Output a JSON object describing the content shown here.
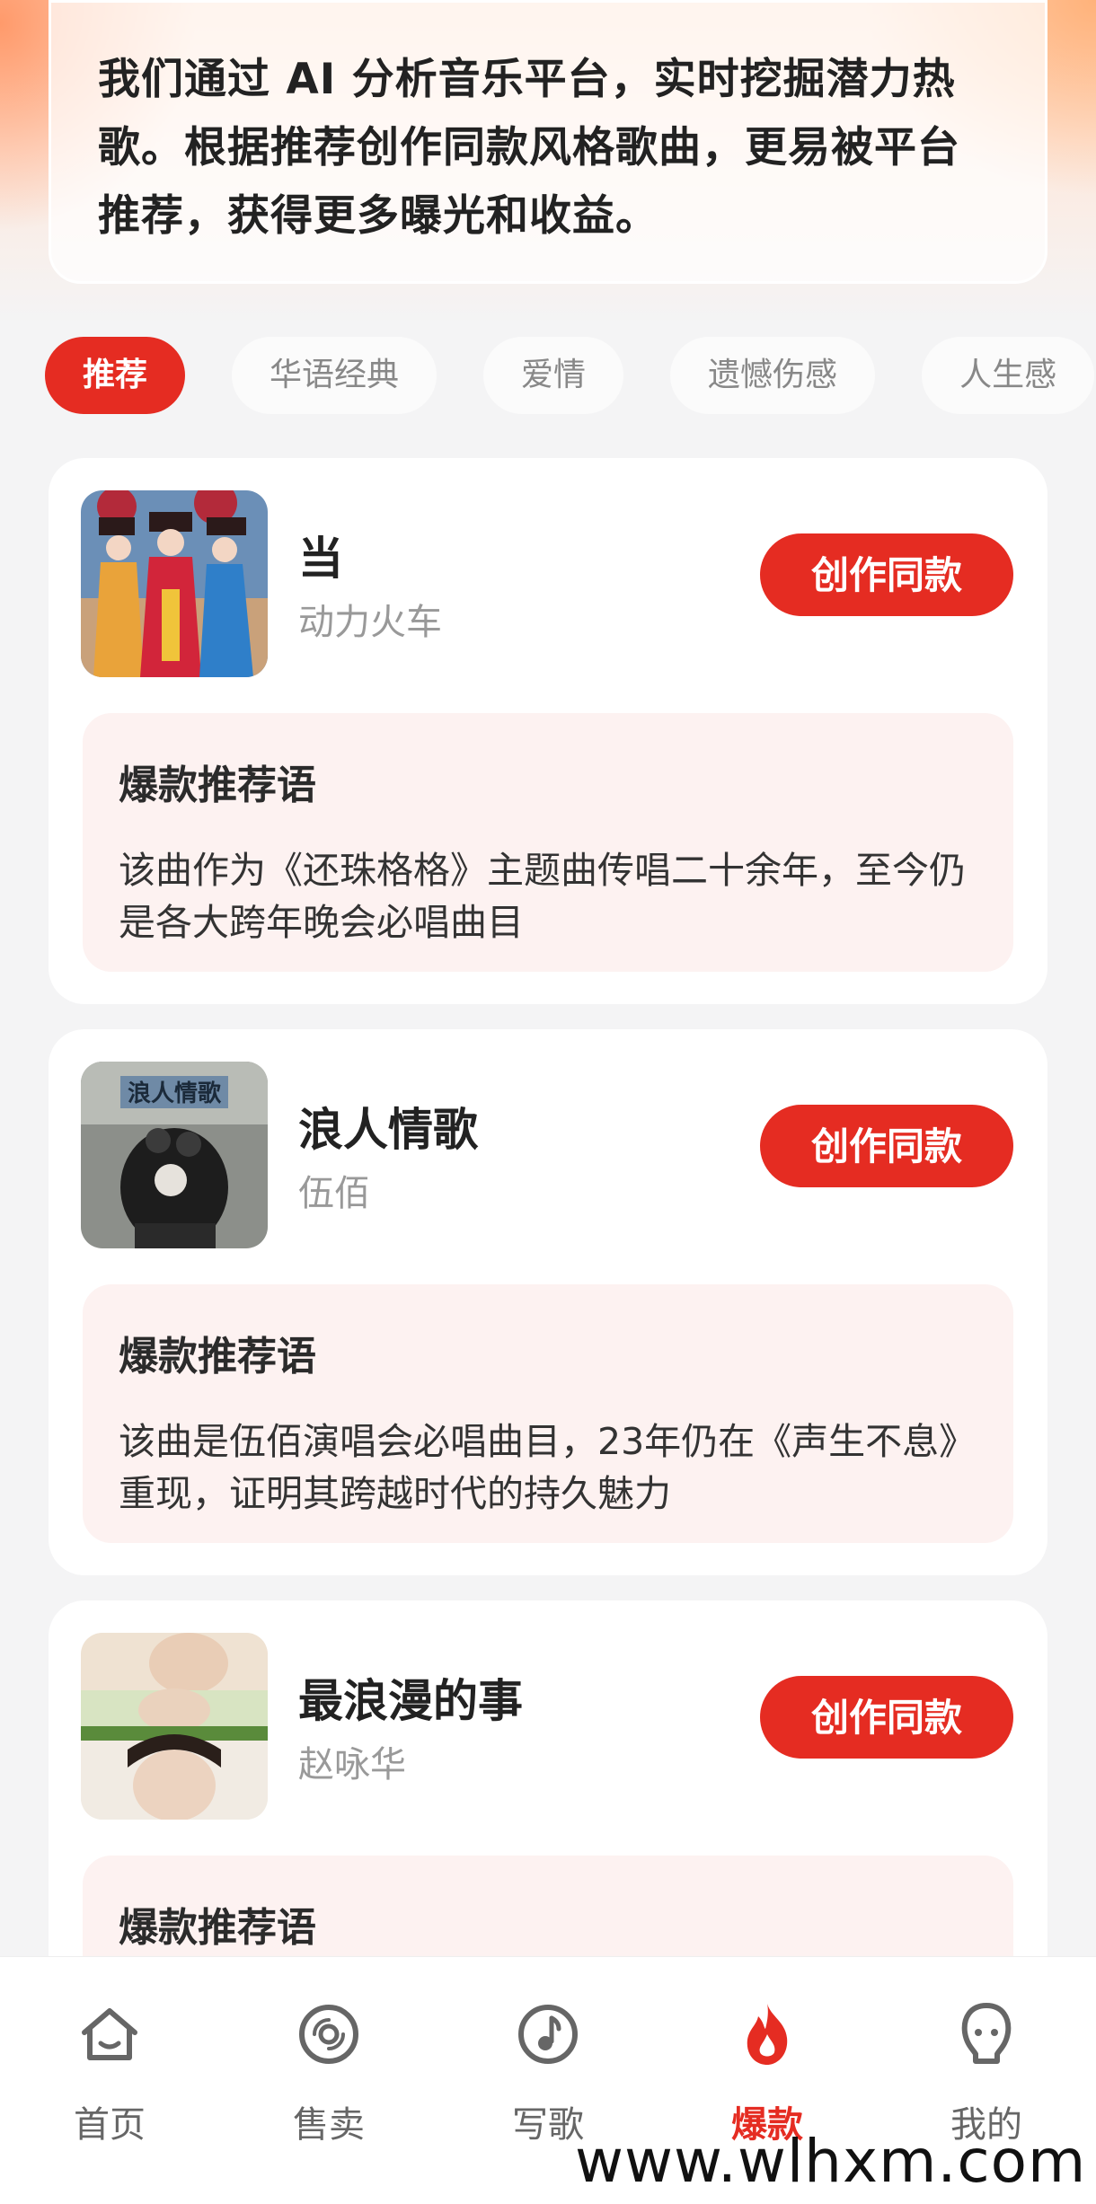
{
  "banner": {
    "text": "我们通过 AI 分析音乐平台，实时挖掘潜力热歌。根据推荐创作同款风格歌曲，更易被平台推荐，获得更多曝光和收益。"
  },
  "tabs": [
    {
      "label": "推荐",
      "active": true
    },
    {
      "label": "华语经典",
      "active": false
    },
    {
      "label": "爱情",
      "active": false
    },
    {
      "label": "遗憾伤感",
      "active": false
    },
    {
      "label": "人生感",
      "active": false
    }
  ],
  "songs": [
    {
      "title": "当",
      "artist": "动力火车",
      "button_label": "创作同款",
      "reco_title": "爆款推荐语",
      "reco_text": "该曲作为《还珠格格》主题曲传唱二十余年，至今仍是各大跨年晚会必唱曲目"
    },
    {
      "title": "浪人情歌",
      "artist": "伍佰",
      "button_label": "创作同款",
      "reco_title": "爆款推荐语",
      "reco_text": "该曲是伍佰演唱会必唱曲目，23年仍在《声生不息》重现，证明其跨越时代的持久魅力",
      "cover_text": "浪人情歌"
    },
    {
      "title": "最浪漫的事",
      "artist": "赵咏华",
      "button_label": "创作同款",
      "reco_title": "爆款推荐语",
      "reco_text": ""
    }
  ],
  "bottom_nav": [
    {
      "label": "首页",
      "icon": "home-icon",
      "active": false
    },
    {
      "label": "售卖",
      "icon": "disc-icon",
      "active": false
    },
    {
      "label": "写歌",
      "icon": "music-note-icon",
      "active": false
    },
    {
      "label": "爆款",
      "icon": "flame-icon",
      "active": true
    },
    {
      "label": "我的",
      "icon": "profile-icon",
      "active": false
    }
  ],
  "watermark": "www.wlhxm.com",
  "colors": {
    "accent": "#e52c22",
    "reco_bg": "#fdf2f1",
    "page_bg": "#f4f4f5"
  }
}
